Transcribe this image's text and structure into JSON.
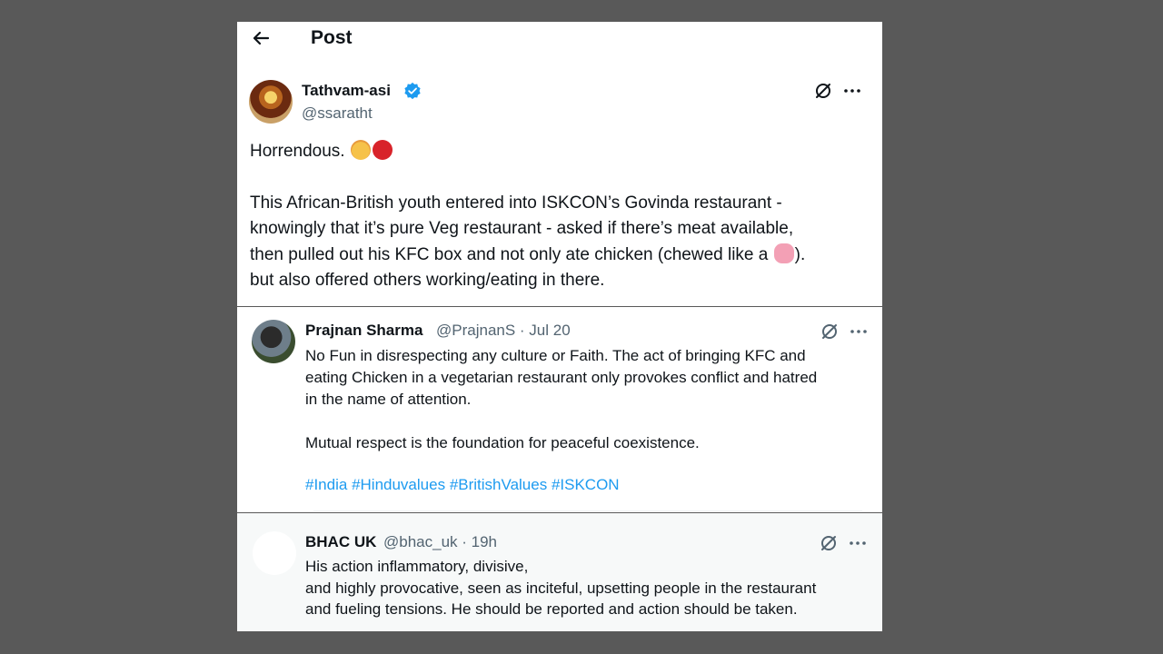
{
  "header": {
    "title": "Post"
  },
  "main_post": {
    "display_name": "Tathvam-asi",
    "handle": "@ssaratht",
    "line1": "Horrendous.",
    "body_lines": [
      "This African-British youth entered into ISKCON’s Govinda restaurant -",
      "knowingly that it’s pure Veg restaurant - asked if there’s meat available,",
      "then pulled out his KFC box and not only ate chicken (chewed like a",
      "but also offered others working/eating in there."
    ],
    "after_pig": ")."
  },
  "replies": [
    {
      "display_name": "Prajnan Sharma",
      "meta": "@PrajnanS · Jul 20",
      "lines": [
        "No Fun in disrespecting any culture or Faith. The act of bringing KFC and",
        "eating Chicken in a vegetarian restaurant only provokes conflict and hatred",
        "in the name of attention."
      ],
      "para2": "Mutual respect is the foundation for peaceful coexistence.",
      "hashtags": [
        "#India",
        "#Hinduvalues",
        "#BritishValues",
        "#ISKCON"
      ]
    },
    {
      "display_name": "BHAC UK",
      "meta": "@bhac_uk · 19h",
      "lines": [
        "His action inflammatory, divisive,",
        "and highly provocative, seen as inciteful, upsetting people in the restaurant",
        "and fueling tensions. He should be reported and action should be taken."
      ]
    }
  ],
  "colors": {
    "background": "#595959",
    "verified": "#1d9bf0",
    "link": "#1d9bf0",
    "secondary_text": "#536471"
  },
  "icons": [
    "back-arrow-icon",
    "verified-badge-icon",
    "grok-icon",
    "more-icon",
    "flushed-face-emoji",
    "angry-face-emoji",
    "pig-face-emoji"
  ]
}
